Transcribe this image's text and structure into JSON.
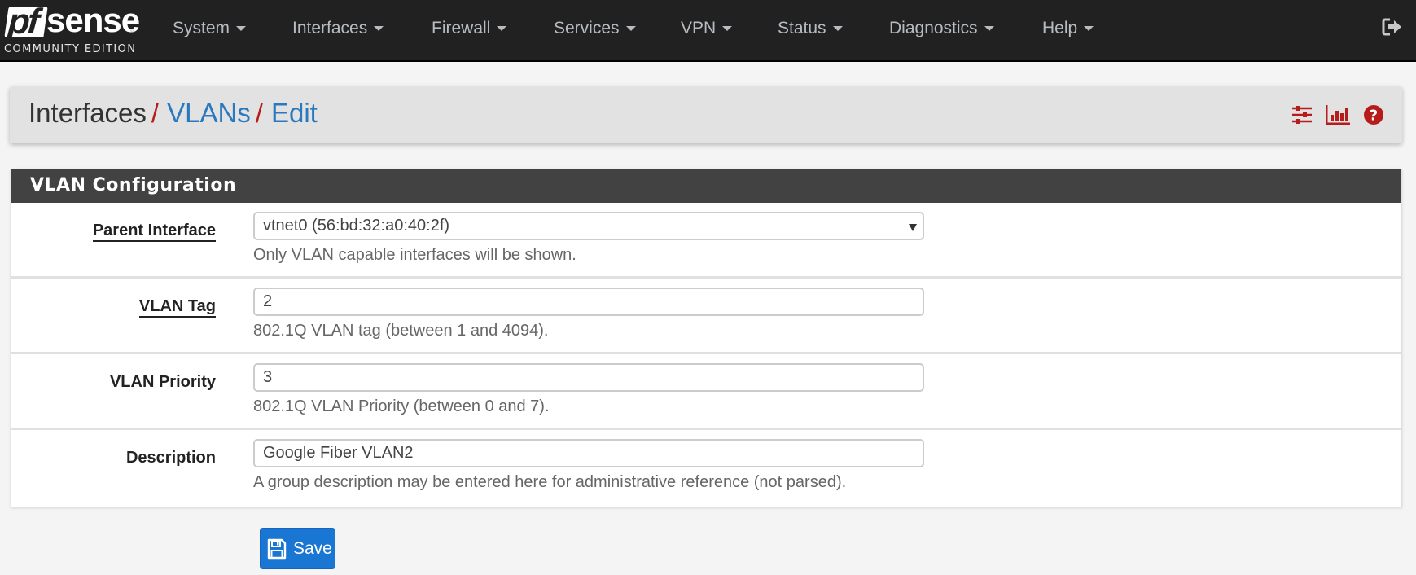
{
  "brand": {
    "logo_pf": "pf",
    "logo_sense": "sense",
    "logo_registered": "®",
    "edition": "COMMUNITY EDITION"
  },
  "nav": {
    "items": [
      {
        "label": "System"
      },
      {
        "label": "Interfaces"
      },
      {
        "label": "Firewall"
      },
      {
        "label": "Services"
      },
      {
        "label": "VPN"
      },
      {
        "label": "Status"
      },
      {
        "label": "Diagnostics"
      },
      {
        "label": "Help"
      }
    ],
    "logout_icon": "sign-out-icon"
  },
  "breadcrumb": {
    "root": "Interfaces",
    "separator": "/",
    "items": [
      {
        "label": "VLANs"
      },
      {
        "label": "Edit"
      }
    ],
    "icons": [
      "sliders-icon",
      "bar-chart-icon",
      "question-circle-icon"
    ],
    "icon_color": "#b71c1c"
  },
  "panel": {
    "title": "VLAN Configuration",
    "fields": [
      {
        "label": "Parent Interface",
        "type": "select",
        "value": "vtnet0 (56:bd:32:a0:40:2f)",
        "help": "Only VLAN capable interfaces will be shown."
      },
      {
        "label": "VLAN Tag",
        "type": "text",
        "value": "2",
        "help": "802.1Q VLAN tag (between 1 and 4094)."
      },
      {
        "label": "VLAN Priority",
        "type": "text",
        "value": "3",
        "help": "802.1Q VLAN Priority (between 0 and 7)."
      },
      {
        "label": "Description",
        "type": "text",
        "value": "Google Fiber VLAN2",
        "help": "A group description may be entered here for administrative reference (not parsed)."
      }
    ]
  },
  "actions": {
    "save_label": "Save",
    "save_icon": "floppy-disk-icon",
    "primary_color": "#1976d2"
  }
}
